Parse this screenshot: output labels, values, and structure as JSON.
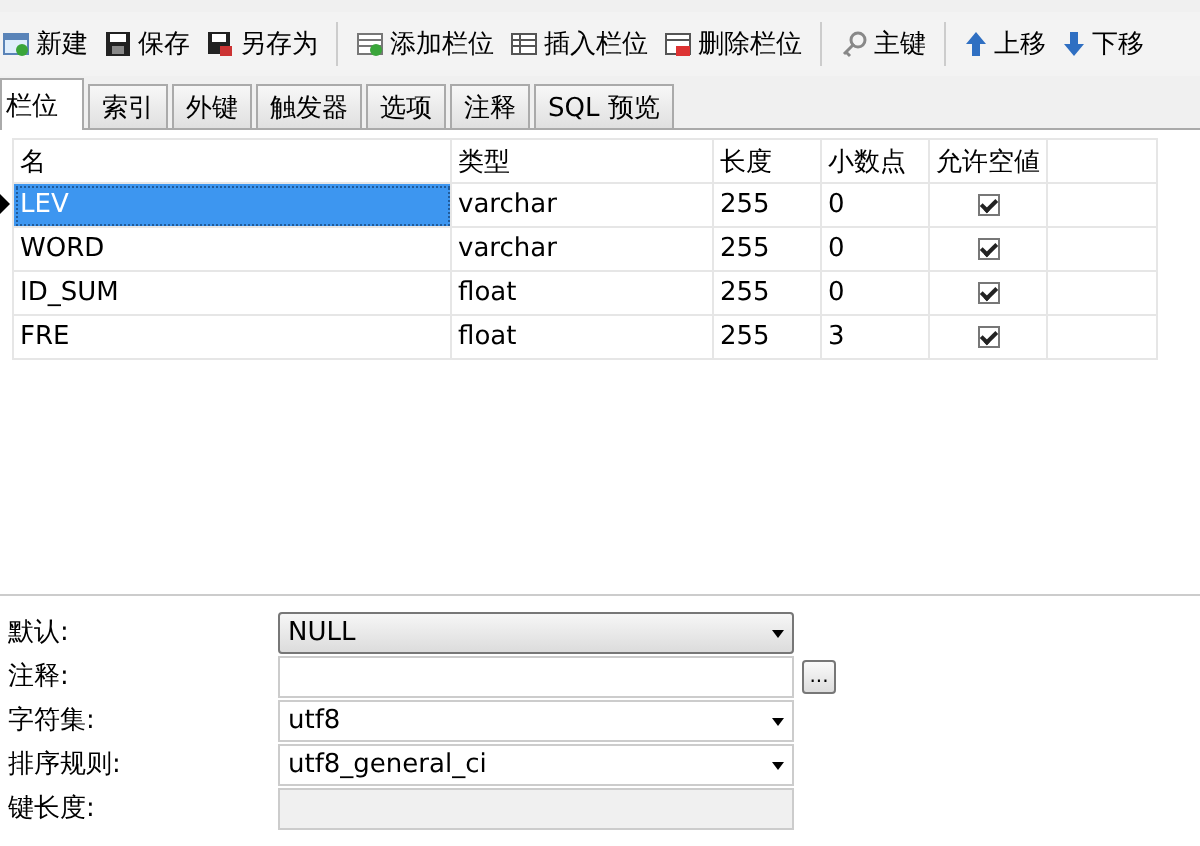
{
  "toolbar": {
    "groups": [
      {
        "items": [
          {
            "label": "新建"
          },
          {
            "label": "保存"
          },
          {
            "label": "另存为"
          }
        ]
      },
      {
        "items": [
          {
            "label": "添加栏位"
          },
          {
            "label": "插入栏位"
          },
          {
            "label": "删除栏位"
          }
        ]
      },
      {
        "items": [
          {
            "label": "主键"
          }
        ]
      },
      {
        "items": [
          {
            "label": "上移"
          },
          {
            "label": "下移"
          }
        ]
      }
    ]
  },
  "tabs": [
    {
      "label": "栏位",
      "selected": true
    },
    {
      "label": "索引",
      "selected": false
    },
    {
      "label": "外键",
      "selected": false
    },
    {
      "label": "触发器",
      "selected": false
    },
    {
      "label": "选项",
      "selected": false
    },
    {
      "label": "注释",
      "selected": false
    },
    {
      "label": "SQL 预览",
      "selected": false
    }
  ],
  "table": {
    "columns": [
      "名",
      "类型",
      "长度",
      "小数点",
      "允许空値"
    ],
    "rows": [
      {
        "name": "LEV",
        "type": "varchar",
        "length": "255",
        "decimals": "0",
        "nullable": true,
        "selected": true
      },
      {
        "name": "WORD",
        "type": "varchar",
        "length": "255",
        "decimals": "0",
        "nullable": true,
        "selected": false
      },
      {
        "name": "ID_SUM",
        "type": "float",
        "length": "255",
        "decimals": "0",
        "nullable": true,
        "selected": false
      },
      {
        "name": "FRE",
        "type": "float",
        "length": "255",
        "decimals": "3",
        "nullable": true,
        "selected": false
      }
    ]
  },
  "properties": [
    {
      "label": "默认:",
      "kind": "combo",
      "value": "NULL"
    },
    {
      "label": "注释:",
      "kind": "text-button",
      "button": "..."
    },
    {
      "label": "字符集:",
      "kind": "select",
      "value": "utf8"
    },
    {
      "label": "排序规则:",
      "kind": "select",
      "value": "utf8_general_ci"
    },
    {
      "label": "键长度:",
      "kind": "disabled"
    }
  ]
}
